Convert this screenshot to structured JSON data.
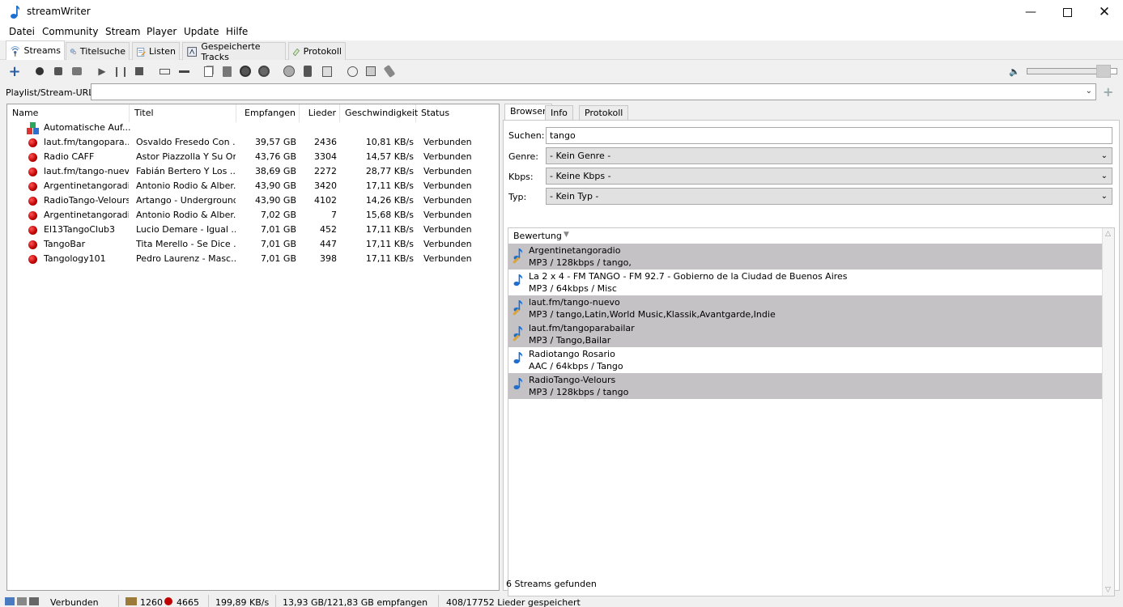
{
  "window": {
    "title": "streamWriter"
  },
  "menu": [
    "Datei",
    "Community",
    "Stream",
    "Player",
    "Update",
    "Hilfe"
  ],
  "tabs": [
    {
      "label": "Streams",
      "icon": "radio-waves-icon"
    },
    {
      "label": "Titelsuche",
      "icon": "search-people-icon"
    },
    {
      "label": "Listen",
      "icon": "list-edit-icon"
    },
    {
      "label": "Gespeicherte Tracks",
      "icon": "saved-tracks-icon"
    },
    {
      "label": "Protokoll",
      "icon": "log-icon"
    }
  ],
  "url": {
    "label": "Playlist/Stream-URL:",
    "value": ""
  },
  "streams": {
    "columns": [
      "Name",
      "Titel",
      "Empfangen",
      "Lieder",
      "Geschwindigkeit",
      "Status"
    ],
    "auto_row": "Automatische Auf...",
    "rows": [
      [
        "laut.fm/tangopara...",
        "Osvaldo Fresedo Con ...",
        "39,57 GB",
        "2436",
        "10,81 KB/s",
        "Verbunden"
      ],
      [
        "Radio CAFF",
        "Astor Piazzolla Y Su Or...",
        "43,76 GB",
        "3304",
        "14,57 KB/s",
        "Verbunden"
      ],
      [
        "laut.fm/tango-nuevo",
        "Fabián Bertero Y Los ...",
        "38,69 GB",
        "2272",
        "28,77 KB/s",
        "Verbunden"
      ],
      [
        "Argentinetangoradio",
        "Antonio Rodio & Alber...",
        "43,90 GB",
        "3420",
        "17,11 KB/s",
        "Verbunden"
      ],
      [
        "RadioTango-Velours",
        "Artango - Underground",
        "43,90 GB",
        "4102",
        "14,26 KB/s",
        "Verbunden"
      ],
      [
        "Argentinetangoradio",
        "Antonio Rodio & Alber...",
        "7,02 GB",
        "7",
        "15,68 KB/s",
        "Verbunden"
      ],
      [
        "El13TangoClub3",
        "Lucio Demare - Igual ...",
        "7,01 GB",
        "452",
        "17,11 KB/s",
        "Verbunden"
      ],
      [
        "TangoBar",
        "Tita Merello - Se Dice ...",
        "7,01 GB",
        "447",
        "17,11 KB/s",
        "Verbunden"
      ],
      [
        "Tangology101",
        "Pedro Laurenz - Masc...",
        "7,01 GB",
        "398",
        "17,11 KB/s",
        "Verbunden"
      ]
    ]
  },
  "browser": {
    "tabs": [
      "Browser",
      "Info",
      "Protokoll"
    ],
    "search_label": "Suchen:",
    "search_value": "tango",
    "genre_label": "Genre:",
    "genre_value": "- Kein Genre -",
    "kbps_label": "Kbps:",
    "kbps_value": "- Keine Kbps -",
    "typ_label": "Typ:",
    "typ_value": "- Kein Typ -",
    "sort_label": "Bewertung",
    "results": [
      {
        "name": "Argentinetangoradio",
        "info": "MP3 / 128kbps / tango,",
        "selected": true,
        "edit": true
      },
      {
        "name": "La 2 x 4 - FM TANGO - FM 92.7 - Gobierno de la Ciudad de Buenos Aires",
        "info": "MP3 / 64kbps / Misc",
        "selected": false,
        "edit": false
      },
      {
        "name": "laut.fm/tango-nuevo",
        "info": "MP3 / tango,Latin,World Music,Klassik,Avantgarde,Indie",
        "selected": true,
        "edit": true
      },
      {
        "name": "laut.fm/tangoparabailar",
        "info": "MP3 / Tango,Bailar",
        "selected": true,
        "edit": true
      },
      {
        "name": "Radiotango Rosario",
        "info": "AAC / 64kbps / Tango",
        "selected": false,
        "edit": false
      },
      {
        "name": "RadioTango-Velours",
        "info": "MP3 / 128kbps / tango",
        "selected": true,
        "edit": false
      }
    ],
    "footer": "6 Streams gefunden"
  },
  "status": {
    "connection": "Verbunden",
    "count_a": "1260",
    "count_b": "4665",
    "speed": "199,89 KB/s",
    "received": "13,93 GB/121,83 GB empfangen",
    "saved": "408/17752 Lieder gespeichert"
  },
  "volume": 0.92,
  "colors": {
    "selection": "#c4c2c4",
    "record": "#c00000",
    "accent": "#1e6fd0"
  }
}
